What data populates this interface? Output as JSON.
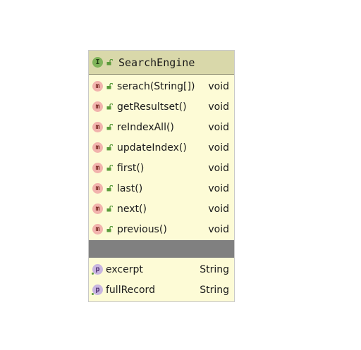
{
  "diagram": {
    "class_name": "SearchEngine",
    "class_badge": "I",
    "method_badge": "m",
    "property_badge": "p",
    "methods": [
      {
        "name": "serach(String[])",
        "type": "void"
      },
      {
        "name": "getResultset()",
        "type": "void"
      },
      {
        "name": "reIndexAll()",
        "type": "void"
      },
      {
        "name": "updateIndex()",
        "type": "void"
      },
      {
        "name": "first()",
        "type": "void"
      },
      {
        "name": "last()",
        "type": "void"
      },
      {
        "name": "next()",
        "type": "void"
      },
      {
        "name": "previous()",
        "type": "void"
      }
    ],
    "properties": [
      {
        "name": "excerpt",
        "type": "String"
      },
      {
        "name": "fullRecord",
        "type": "String"
      }
    ]
  },
  "colors": {
    "header_bg": "#d9d8aa",
    "body_bg": "#fdfbd6",
    "separator": "#808080",
    "interface_badge": "#7fb35a",
    "method_badge": "#f2b3ad",
    "property_badge": "#c9b6e0",
    "lock": "#5a9a3a"
  },
  "icons": {
    "interface": "interface-icon",
    "method": "method-icon",
    "property": "property-icon",
    "visibility": "public-lock-icon"
  }
}
